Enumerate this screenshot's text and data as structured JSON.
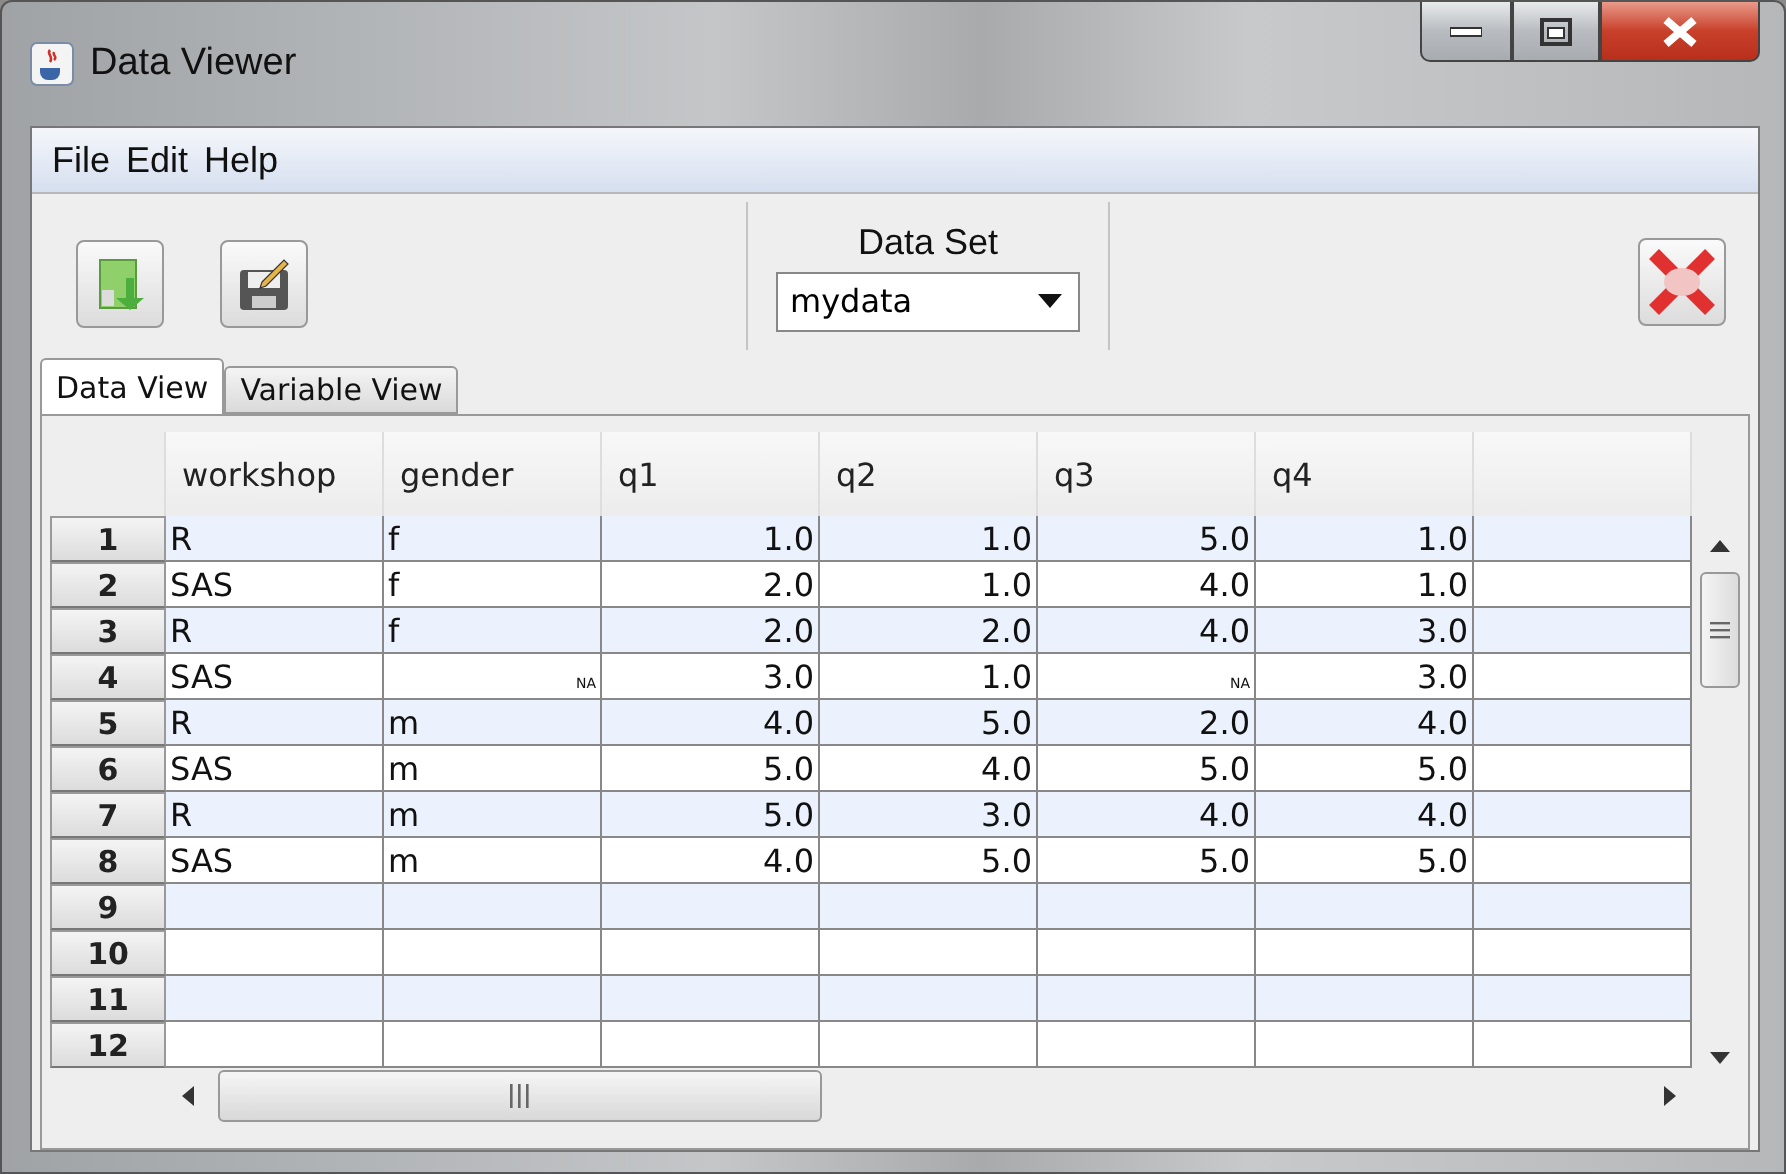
{
  "window": {
    "title": "Data Viewer"
  },
  "menu": [
    "File",
    "Edit",
    "Help"
  ],
  "dataset": {
    "label": "Data Set",
    "value": "mydata"
  },
  "tabs": [
    {
      "label": "Data View",
      "selected": true
    },
    {
      "label": "Variable View",
      "selected": false
    }
  ],
  "table": {
    "columns": [
      {
        "label": "workshop",
        "kind": "text"
      },
      {
        "label": "gender",
        "kind": "text"
      },
      {
        "label": "q1",
        "kind": "numeric"
      },
      {
        "label": "q2",
        "kind": "numeric"
      },
      {
        "label": "q3",
        "kind": "numeric"
      },
      {
        "label": "q4",
        "kind": "numeric"
      }
    ],
    "rows": [
      {
        "label": "1",
        "cells": [
          {
            "text": "R"
          },
          {
            "text": "f"
          },
          {
            "text": "1.0"
          },
          {
            "text": "1.0"
          },
          {
            "text": "5.0"
          },
          {
            "text": "1.0"
          }
        ]
      },
      {
        "label": "2",
        "cells": [
          {
            "text": "SAS"
          },
          {
            "text": "f"
          },
          {
            "text": "2.0"
          },
          {
            "text": "1.0"
          },
          {
            "text": "4.0"
          },
          {
            "text": "1.0"
          }
        ]
      },
      {
        "label": "3",
        "cells": [
          {
            "text": "R"
          },
          {
            "text": "f"
          },
          {
            "text": "2.0"
          },
          {
            "text": "2.0"
          },
          {
            "text": "4.0"
          },
          {
            "text": "3.0"
          }
        ]
      },
      {
        "label": "4",
        "cells": [
          {
            "text": "SAS"
          },
          {
            "text": "NA",
            "missing": true
          },
          {
            "text": "3.0"
          },
          {
            "text": "1.0"
          },
          {
            "text": "NA",
            "missing": true
          },
          {
            "text": "3.0"
          }
        ]
      },
      {
        "label": "5",
        "cells": [
          {
            "text": "R"
          },
          {
            "text": "m"
          },
          {
            "text": "4.0"
          },
          {
            "text": "5.0"
          },
          {
            "text": "2.0"
          },
          {
            "text": "4.0"
          }
        ]
      },
      {
        "label": "6",
        "cells": [
          {
            "text": "SAS"
          },
          {
            "text": "m"
          },
          {
            "text": "5.0"
          },
          {
            "text": "4.0"
          },
          {
            "text": "5.0"
          },
          {
            "text": "5.0"
          }
        ]
      },
      {
        "label": "7",
        "cells": [
          {
            "text": "R"
          },
          {
            "text": "m"
          },
          {
            "text": "5.0"
          },
          {
            "text": "3.0"
          },
          {
            "text": "4.0"
          },
          {
            "text": "4.0"
          }
        ]
      },
      {
        "label": "8",
        "cells": [
          {
            "text": "SAS"
          },
          {
            "text": "m"
          },
          {
            "text": "4.0"
          },
          {
            "text": "5.0"
          },
          {
            "text": "5.0"
          },
          {
            "text": "5.0"
          }
        ]
      },
      {
        "label": "9"
      },
      {
        "label": "10"
      },
      {
        "label": "11"
      },
      {
        "label": "12"
      }
    ]
  }
}
